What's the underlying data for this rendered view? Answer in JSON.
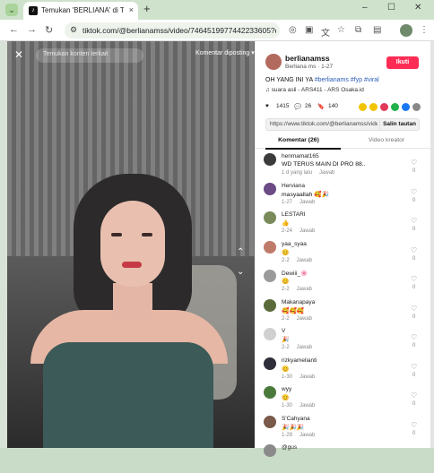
{
  "browser": {
    "tab_title": "Temukan 'BERLIANA' di TikTok",
    "tab_logo": "tiktok-logo",
    "tab_close": "×",
    "new_tab": "+",
    "win_minimize": "–",
    "win_maximize": "☐",
    "win_close": "✕",
    "url": "tiktok.com/@berlianamss/video/7464519977442233605?q=BE..."
  },
  "video": {
    "close": "✕",
    "search_placeholder": "Temukan konten terkait",
    "report": "Komentar diposting ▾",
    "chev_up": "⌃",
    "chev_down": "⌄"
  },
  "author": {
    "username": "berlianamss",
    "subtitle": "Berliana ms · 1-27",
    "follow_label": "Ikuti",
    "caption_plain": "OH YANG INI YA ",
    "caption_tags": "#berlianams #fyp #viral",
    "music": "♫ suara asli - ARS411 - ARS Osaka.id",
    "likes": "1415",
    "comments": "26",
    "bookmarks": "140",
    "link": "https://www.tiktok.com/@berlianamss/video/7464...",
    "copy_label": "Salin tautan"
  },
  "tabs": {
    "comments": "Komentar (26)",
    "creator_videos": "Video kreator"
  },
  "comments": [
    {
      "user": "henmamat165",
      "text": "WD TERUS MAIN DI PRO 88..",
      "meta": "1 d yang lalu",
      "reply": "Jawab",
      "likes": "0",
      "color": "#3b3b3b"
    },
    {
      "user": "Herviana",
      "text": "masyaallah 🥰🎉",
      "meta": "1-27",
      "reply": "Jawab",
      "likes": "0",
      "color": "#6b4a86"
    },
    {
      "user": "LESTARI",
      "text": "👍",
      "meta": "2-24",
      "reply": "Jawab",
      "likes": "0",
      "color": "#7a8a5a"
    },
    {
      "user": "yaa_syaa",
      "text": "😊",
      "meta": "2-2",
      "reply": "Jawab",
      "likes": "0",
      "color": "#c07a6a"
    },
    {
      "user": "Dewiii_🌸",
      "text": "😊",
      "meta": "2-2",
      "reply": "Jawab",
      "likes": "0",
      "color": "#9a9a9a"
    },
    {
      "user": "Makanapaya",
      "text": "🥰🥰🥰",
      "meta": "2-2",
      "reply": "Jawab",
      "likes": "0",
      "color": "#5a6a3a"
    },
    {
      "user": "V",
      "text": "🎉",
      "meta": "2-2",
      "reply": "Jawab",
      "likes": "0",
      "color": "#d0d0d0"
    },
    {
      "user": "rizkyamelianti",
      "text": "😊",
      "meta": "1-30",
      "reply": "Jawab",
      "likes": "0",
      "color": "#2e2e3a"
    },
    {
      "user": "wyy",
      "text": "😊",
      "meta": "1-30",
      "reply": "Jawab",
      "likes": "0",
      "color": "#4a7a3a"
    },
    {
      "user": "S'Cahyana",
      "text": "🎉🎉🎉",
      "meta": "1-29",
      "reply": "Jawab",
      "likes": "0",
      "color": "#7a5a4a"
    },
    {
      "user": "@gus",
      "text": "",
      "meta": "",
      "reply": "",
      "likes": "",
      "color": "#8a8a8a"
    }
  ]
}
